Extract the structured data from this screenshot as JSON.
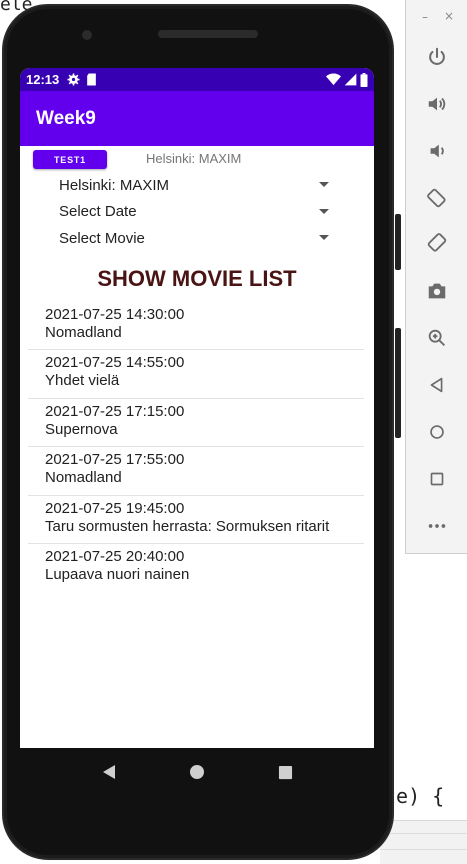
{
  "ide": {
    "top_text": "ele",
    "bottom_code": "te) {"
  },
  "emulator_toolbar": {
    "minimize": "–",
    "close": "×",
    "buttons": [
      {
        "icon": "power-icon"
      },
      {
        "icon": "volume-up-icon"
      },
      {
        "icon": "volume-down-icon"
      },
      {
        "icon": "rotate-left-icon"
      },
      {
        "icon": "rotate-right-icon"
      },
      {
        "icon": "camera-icon"
      },
      {
        "icon": "zoom-icon"
      },
      {
        "icon": "back-icon"
      },
      {
        "icon": "home-icon"
      },
      {
        "icon": "overview-icon"
      },
      {
        "icon": "more-icon"
      }
    ]
  },
  "status_bar": {
    "time": "12:13",
    "icons": [
      "settings-icon",
      "sd-card-icon",
      "wifi-icon",
      "signal-icon",
      "battery-icon"
    ],
    "color": "#3700b3"
  },
  "app_bar": {
    "title": "Week9",
    "color": "#6200ee"
  },
  "controls": {
    "test_button": "TEST1",
    "selected_theater": "Helsinki: MAXIM",
    "spinners": [
      {
        "value": "Helsinki: MAXIM"
      },
      {
        "value": "Select Date"
      },
      {
        "value": "Select Movie"
      }
    ],
    "show_button": "SHOW MOVIE LIST",
    "show_button_color": "#4a1414"
  },
  "shows": [
    {
      "datetime": "2021-07-25  14:30:00",
      "title": "Nomadland"
    },
    {
      "datetime": "2021-07-25  14:55:00",
      "title": "Yhdet vielä"
    },
    {
      "datetime": "2021-07-25  17:15:00",
      "title": "Supernova"
    },
    {
      "datetime": "2021-07-25  17:55:00",
      "title": "Nomadland"
    },
    {
      "datetime": "2021-07-25  19:45:00",
      "title": "Taru sormusten herrasta: Sormuksen ritarit"
    },
    {
      "datetime": "2021-07-25  20:40:00",
      "title": "Lupaava nuori nainen"
    }
  ],
  "nav_bar": {
    "buttons": [
      "back-icon",
      "home-icon",
      "recents-icon"
    ]
  }
}
